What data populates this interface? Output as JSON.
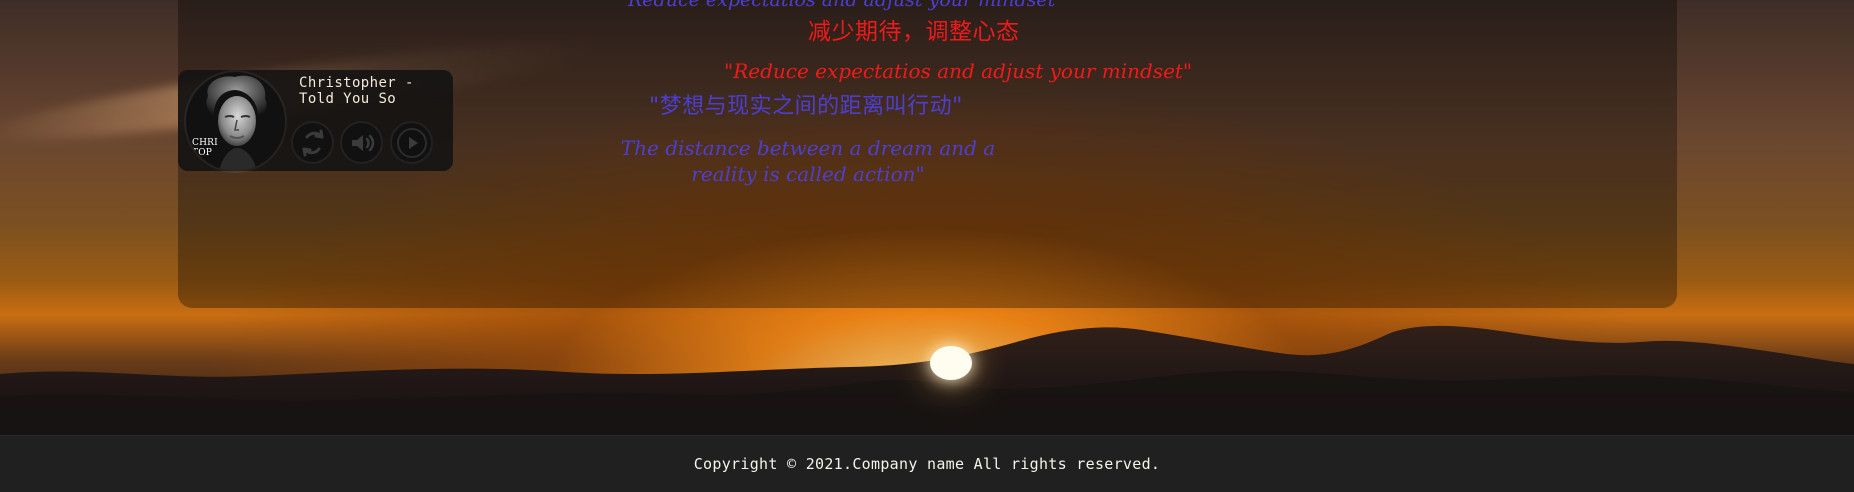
{
  "player": {
    "track_title": "Christopher - Told You So",
    "cover_label": "CHRI\nTOP"
  },
  "quotes": {
    "partial_top": "Reduce expectatios and adjust your mindset",
    "red_chinese": "减少期待，调整心态",
    "red_english": "\"Reduce expectatios and adjust your mindset\"",
    "blue_chinese": "\"梦想与现实之间的距离叫行动\"",
    "blue_english": "The distance between a dream and a reality is called action\""
  },
  "footer": {
    "copyright": "Copyright © 2021.Company name All rights reserved."
  },
  "icons": {
    "loop": "loop-icon",
    "volume": "volume-icon",
    "play": "play-icon"
  },
  "colors": {
    "quote_red": "#f01a1a",
    "quote_blue": "#4d40dc",
    "footer_bg": "#202020",
    "player_bg": "#121212"
  }
}
